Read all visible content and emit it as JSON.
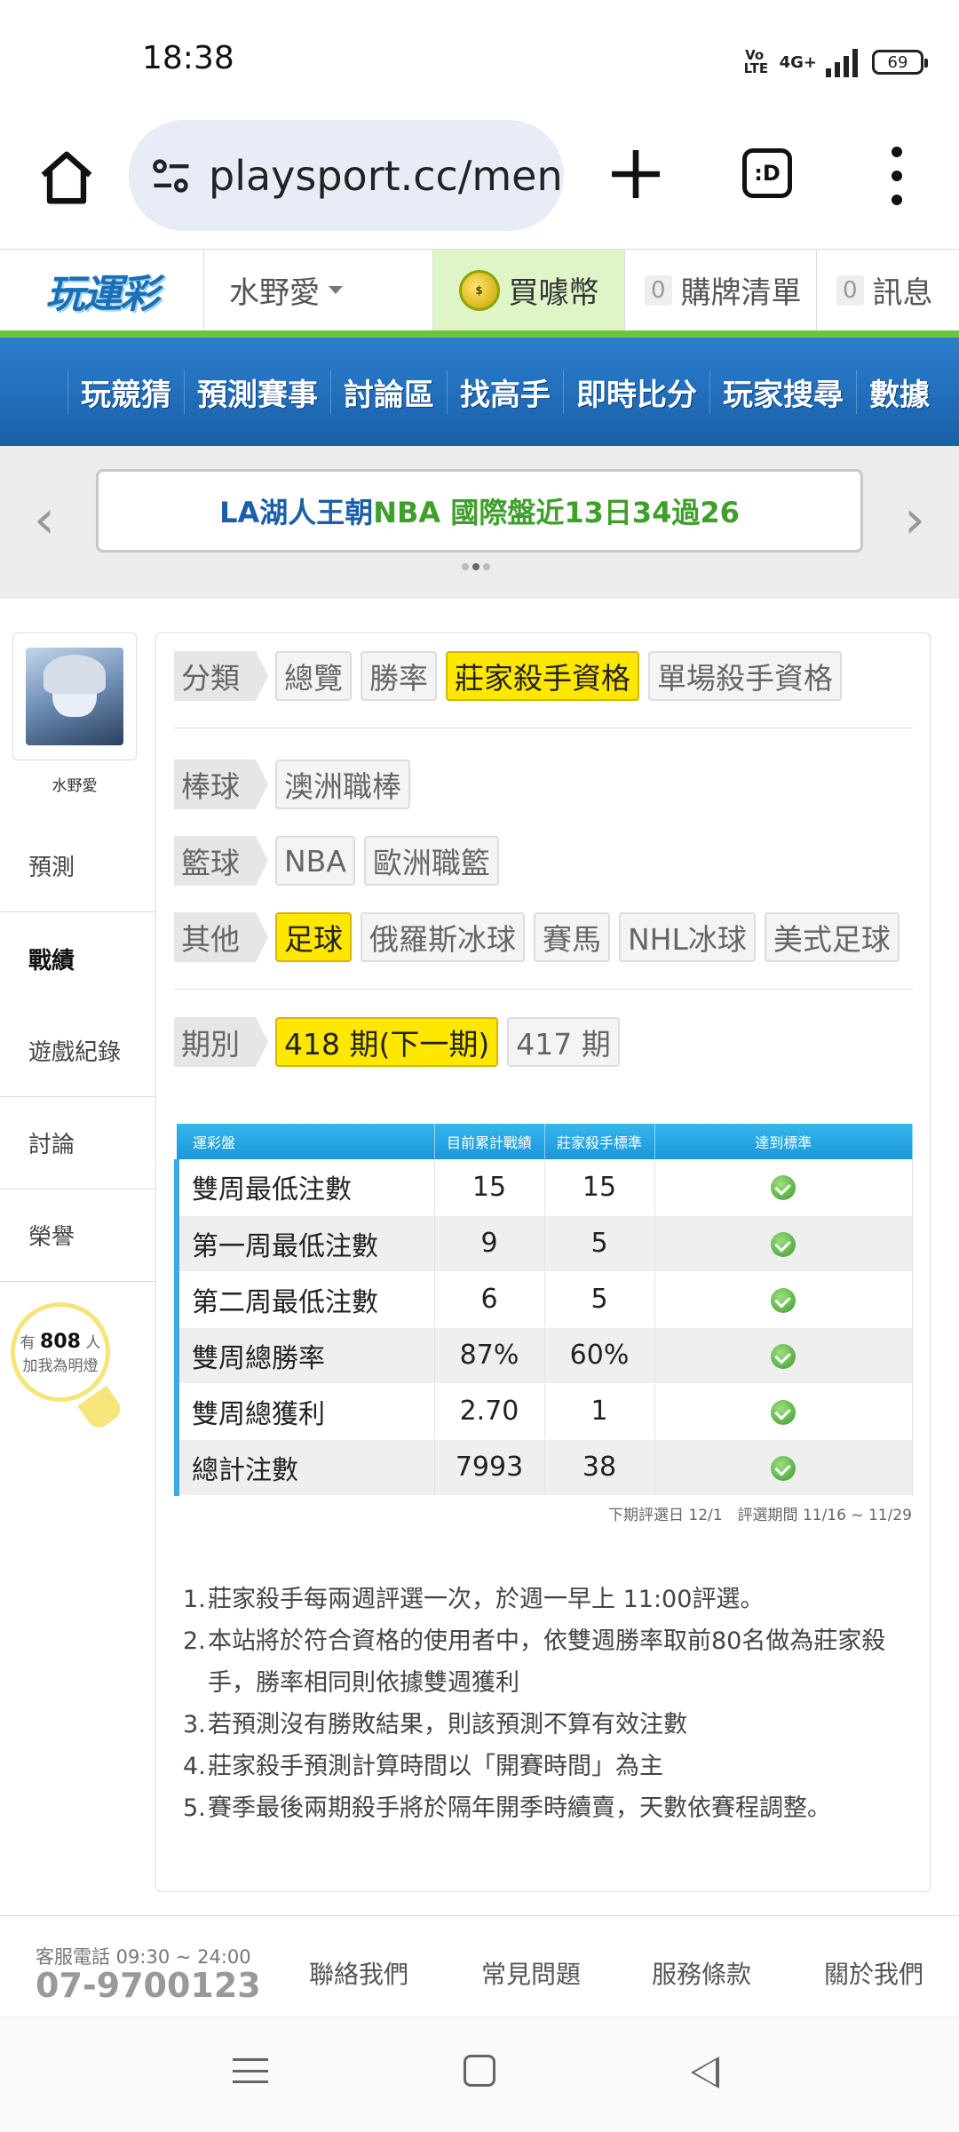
{
  "status_bar": {
    "time": "18:38",
    "volte": "Vo LTE",
    "network": "4G+",
    "battery": "69"
  },
  "browser": {
    "url": "playsport.cc/men"
  },
  "header": {
    "logo": "玩運彩",
    "user_name": "水野愛",
    "buy_coins": "買噱幣",
    "purchase_list": {
      "count": "0",
      "label": "購牌清單"
    },
    "messages": {
      "count": "0",
      "label": "訊息"
    }
  },
  "nav": [
    "玩競猜",
    "預測賽事",
    "討論區",
    "找高手",
    "即時比分",
    "玩家搜尋",
    "數據"
  ],
  "banner": {
    "part1": "LA湖人王朝 ",
    "part2": "NBA 國際盤近13日34過26"
  },
  "sidebar": {
    "name": "水野愛",
    "tabs": [
      "預測",
      "戰績",
      "遊戲紀錄",
      "討論",
      "榮譽"
    ],
    "fans": {
      "prefix": "有",
      "count": "808",
      "suffix": "人",
      "cta": "加我為明燈"
    }
  },
  "filters": {
    "category": {
      "label": "分類",
      "options": [
        "總覽",
        "勝率",
        "莊家殺手資格",
        "單場殺手資格"
      ],
      "selected": "莊家殺手資格"
    },
    "baseball": {
      "label": "棒球",
      "options": [
        "澳洲職棒"
      ]
    },
    "basketball": {
      "label": "籃球",
      "options": [
        "NBA",
        "歐洲職籃"
      ]
    },
    "other": {
      "label": "其他",
      "options": [
        "足球",
        "俄羅斯冰球",
        "賽馬",
        "NHL冰球",
        "美式足球"
      ],
      "selected": "足球"
    },
    "period": {
      "label": "期別",
      "options": [
        "418 期(下一期)",
        "417 期"
      ],
      "selected": "418 期(下一期)"
    }
  },
  "table": {
    "headers": [
      "運彩盤",
      "目前累計戰績",
      "莊家殺手標準",
      "達到標準"
    ],
    "rows": [
      {
        "name": "雙周最低注數",
        "current": "15",
        "standard": "15",
        "met": true
      },
      {
        "name": "第一周最低注數",
        "current": "9",
        "standard": "5",
        "met": true
      },
      {
        "name": "第二周最低注數",
        "current": "6",
        "standard": "5",
        "met": true
      },
      {
        "name": "雙周總勝率",
        "current": "87%",
        "standard": "60%",
        "met": true
      },
      {
        "name": "雙周總獲利",
        "current": "2.70",
        "standard": "1",
        "met": true
      },
      {
        "name": "總計注數",
        "current": "7993",
        "standard": "38",
        "met": true
      }
    ],
    "note": "下期評選日 12/1　評選期間 11/16 ~ 11/29"
  },
  "rules": [
    "莊家殺手每兩週評選一次，於週一早上 11:00評選。",
    "本站將於符合資格的使用者中，依雙週勝率取前80名做為莊家殺手，勝率相同則依據雙週獲利",
    "若預測沒有勝敗結果，則該預測不算有效注數",
    "莊家殺手預測計算時間以「開賽時間」為主",
    "賽季最後兩期殺手將於隔年開季時續賣，天數依賽程調整。"
  ],
  "footer": {
    "service_hours": "客服電話 09:30 ~ 24:00",
    "phone": "07-9700123",
    "links": [
      "聯絡我們",
      "常見問題",
      "服務條款",
      "關於我們"
    ]
  },
  "colors": {
    "nav_blue": "#1a5fa8",
    "accent_green": "#6ac43c",
    "selected_yellow": "#ffe700",
    "table_header": "#1a98d9"
  }
}
